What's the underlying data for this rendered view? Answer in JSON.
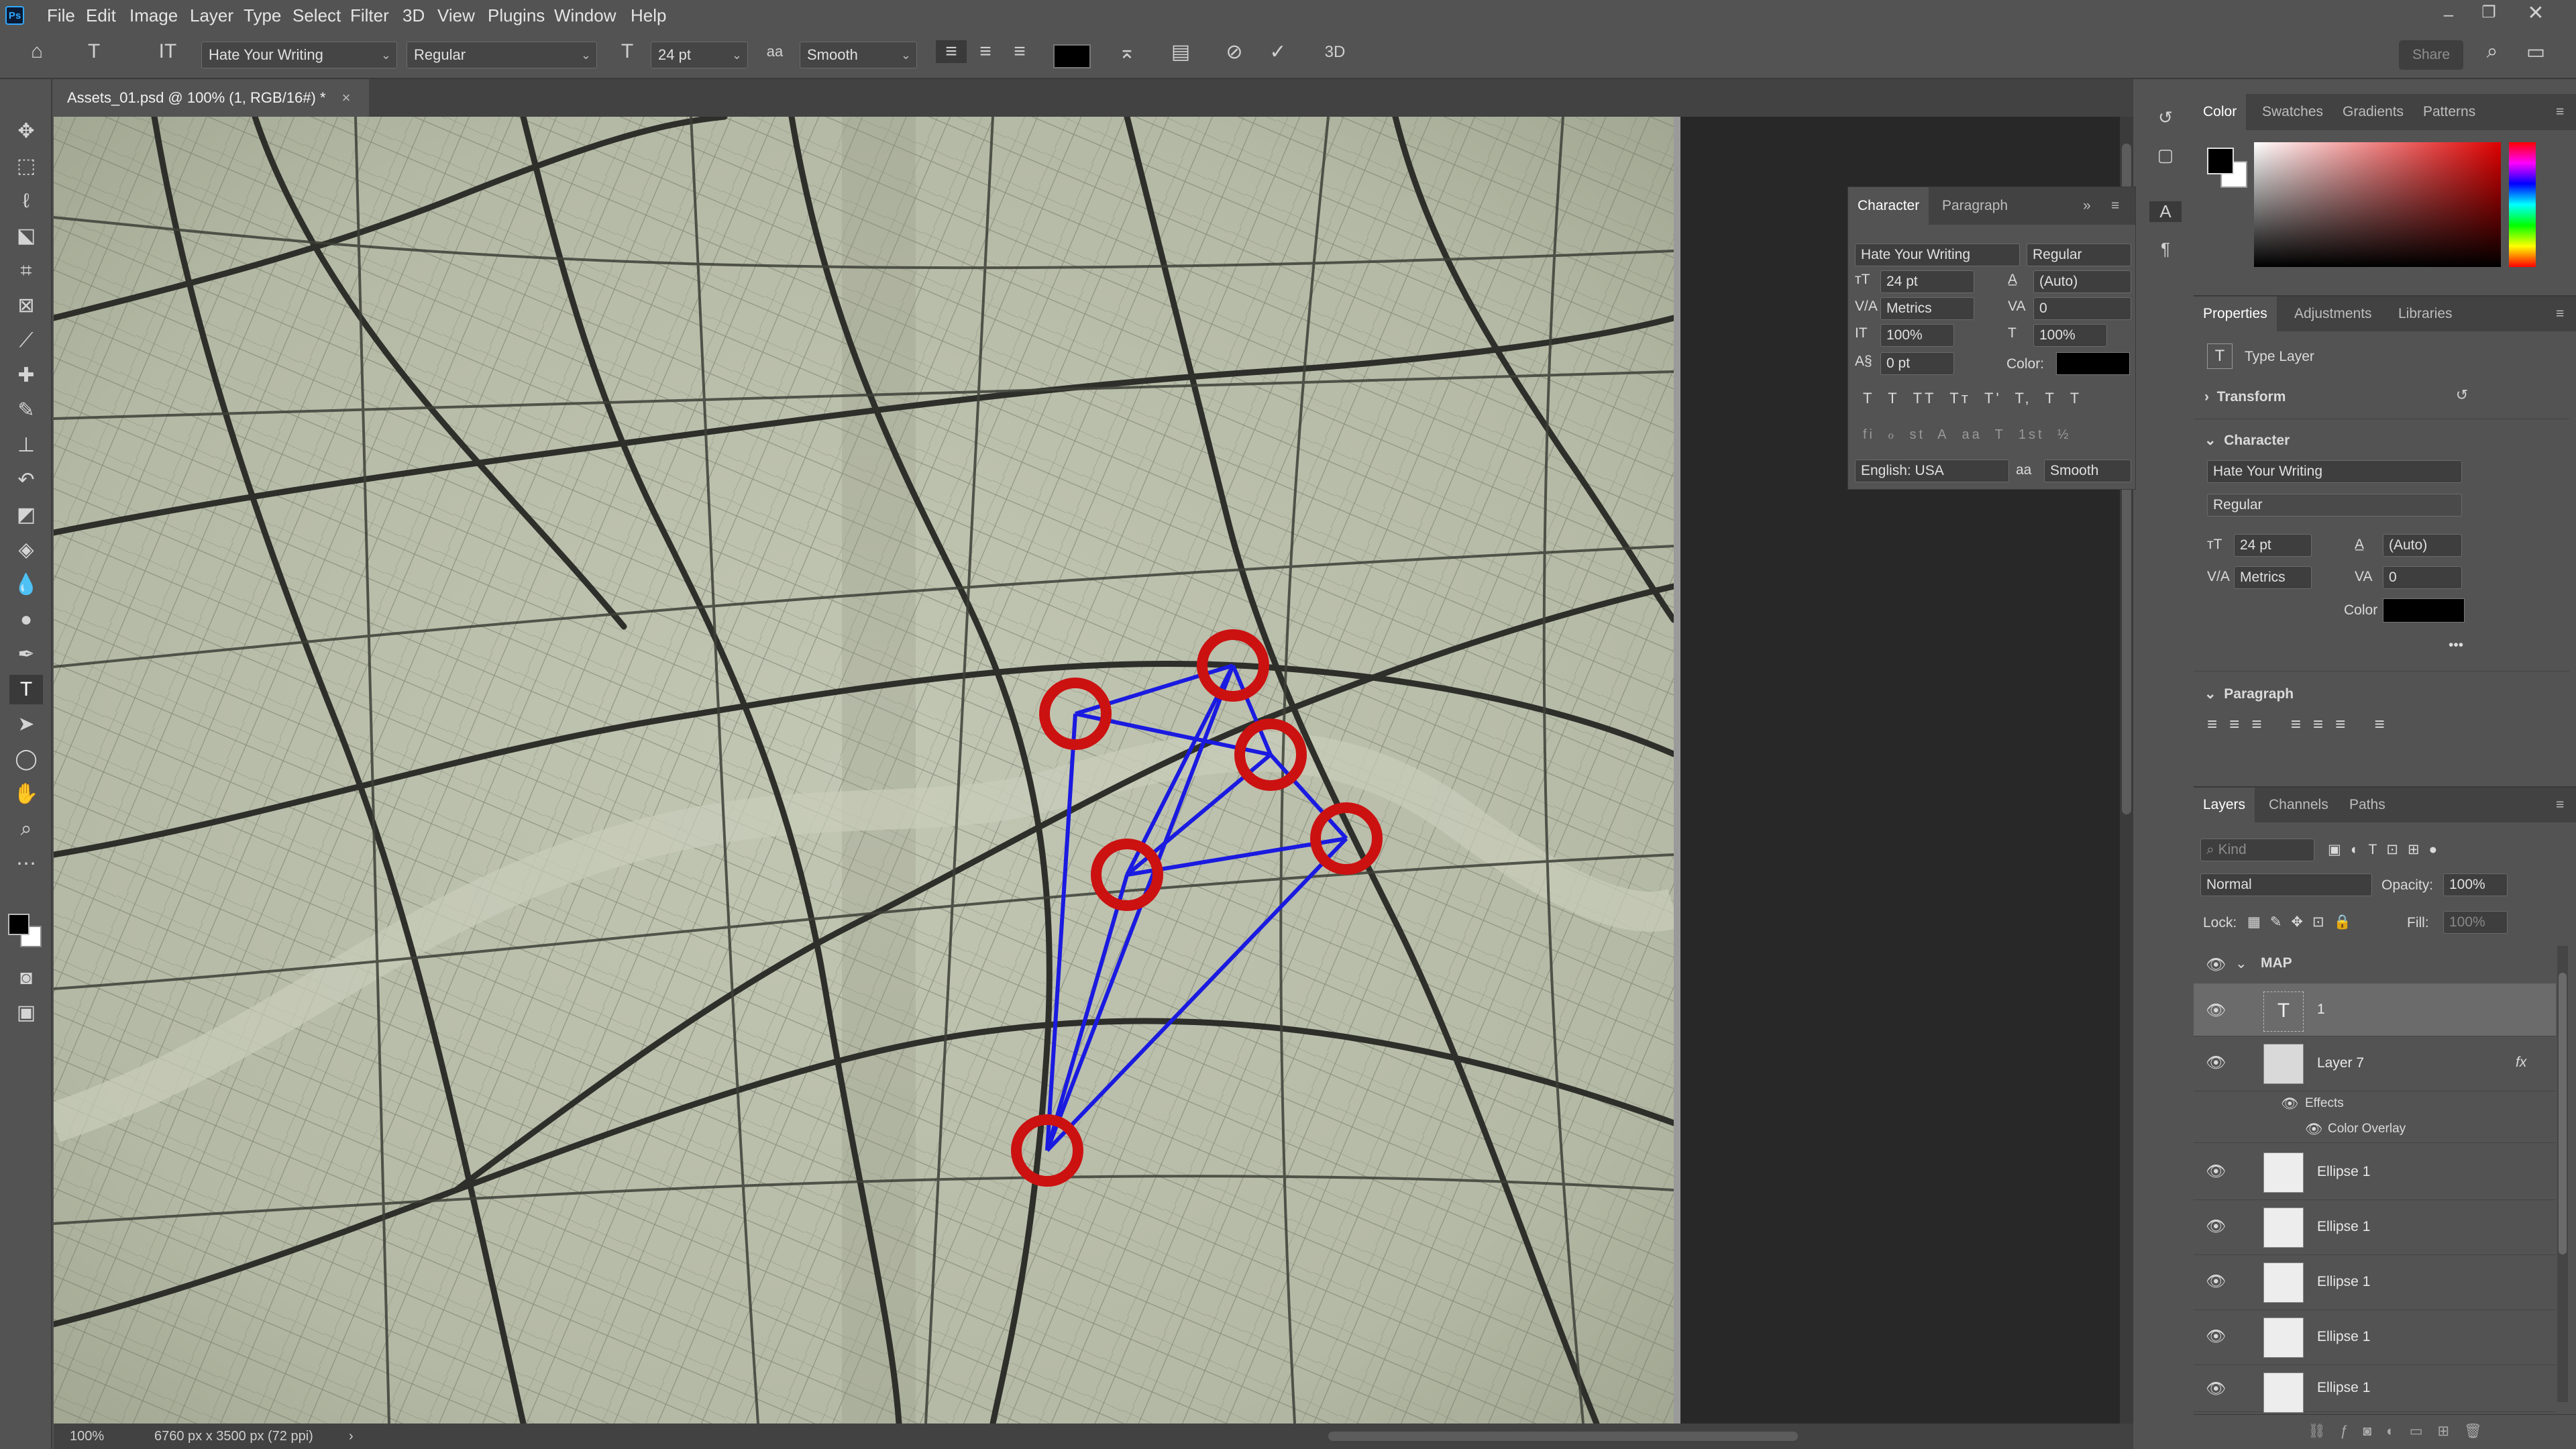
{
  "menubar": {
    "logo": "Ps",
    "items": [
      "File",
      "Edit",
      "Image",
      "Layer",
      "Type",
      "Select",
      "Filter",
      "3D",
      "View",
      "Plugins",
      "Window",
      "Help"
    ]
  },
  "options": {
    "font_family": "Hate Your Writing",
    "font_style": "Regular",
    "font_size": "24 pt",
    "aa_icon": "aa",
    "antialias": "Smooth",
    "mode_3d": "3D",
    "share": "Share",
    "text_color": "#000000"
  },
  "document": {
    "tab_title": "Assets_01.psd @ 100% (1, RGB/16#) *",
    "tab_close": "×",
    "zoom": "100%",
    "doc_info": "6760 px x 3500 px (72 ppi)",
    "status_arrow": "›"
  },
  "character_panel": {
    "tabs": [
      "Character",
      "Paragraph"
    ],
    "font_family": "Hate Your Writing",
    "font_style": "Regular",
    "size": "24 pt",
    "leading": "(Auto)",
    "kerning": "Metrics",
    "tracking": "0",
    "vscale": "100%",
    "hscale": "100%",
    "baseline": "0 pt",
    "color_label": "Color:",
    "language": "English: USA",
    "aa_icon": "aa",
    "antialias": "Smooth",
    "style_buttons_1": [
      "T",
      "T",
      "TT",
      "Tт",
      "T'",
      "T,",
      "T",
      "T"
    ],
    "style_buttons_2": [
      "fi",
      "ℴ",
      "st",
      "A",
      "aa",
      "T",
      "1st",
      "½"
    ]
  },
  "color_panel": {
    "tabs": [
      "Color",
      "Swatches",
      "Gradients",
      "Patterns"
    ],
    "fg": "#000000",
    "bg": "#ffffff",
    "hue": "#e00000"
  },
  "properties_panel": {
    "tabs": [
      "Properties",
      "Adjustments",
      "Libraries"
    ],
    "type_layer": "Type Layer",
    "transform": "Transform",
    "character": "Character",
    "font_family": "Hate Your Writing",
    "font_style": "Regular",
    "size": "24 pt",
    "leading": "(Auto)",
    "kerning": "Metrics",
    "tracking": "0",
    "color_label": "Color",
    "more": "•••",
    "paragraph": "Paragraph"
  },
  "layers_panel": {
    "tabs": [
      "Layers",
      "Channels",
      "Paths"
    ],
    "search_placeholder": "Kind",
    "blend_mode": "Normal",
    "opacity_label": "Opacity:",
    "opacity": "100%",
    "lock_label": "Lock:",
    "fill_label": "Fill:",
    "fill": "100%",
    "group": "MAP",
    "text_layer": "1",
    "layer7": "Layer 7",
    "fx": "fx",
    "effects": "Effects",
    "color_overlay": "Color Overlay",
    "ellipses": [
      "Ellipse 1",
      "Ellipse 1",
      "Ellipse 1",
      "Ellipse 1",
      "Ellipse 1"
    ]
  },
  "map": {
    "marker_color": "#cc1111",
    "line_color": "#1a1ae0",
    "paper_color": "#b5baa6"
  }
}
